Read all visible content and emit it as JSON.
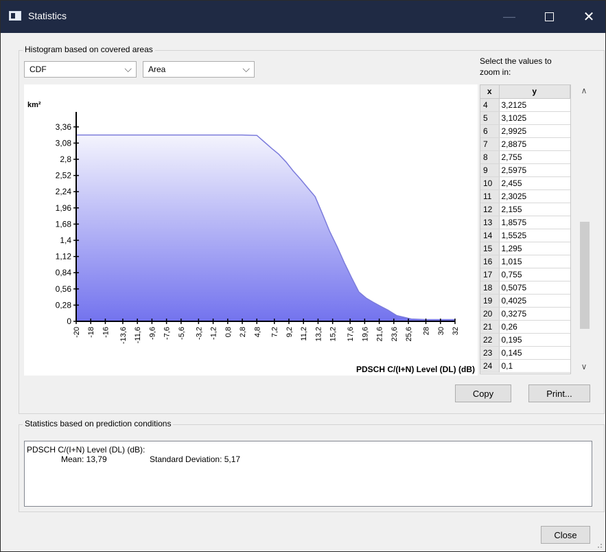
{
  "window": {
    "title": "Statistics",
    "minimize_glyph": "—",
    "close_glyph": "✕"
  },
  "histogram_group": {
    "label": "Histogram based on covered areas",
    "type_combo": {
      "value": "CDF"
    },
    "measure_combo": {
      "value": "Area"
    }
  },
  "zoom": {
    "label_line1": "Select the values to",
    "label_line2": "zoom in:",
    "table": {
      "headers": [
        "x",
        "y"
      ],
      "rows": [
        [
          "4",
          "3,2125"
        ],
        [
          "5",
          "3,1025"
        ],
        [
          "6",
          "2,9925"
        ],
        [
          "7",
          "2,8875"
        ],
        [
          "8",
          "2,755"
        ],
        [
          "9",
          "2,5975"
        ],
        [
          "10",
          "2,455"
        ],
        [
          "11",
          "2,3025"
        ],
        [
          "12",
          "2,155"
        ],
        [
          "13",
          "1,8575"
        ],
        [
          "14",
          "1,5525"
        ],
        [
          "15",
          "1,295"
        ],
        [
          "16",
          "1,015"
        ],
        [
          "17",
          "0,755"
        ],
        [
          "18",
          "0,5075"
        ],
        [
          "19",
          "0,4025"
        ],
        [
          "20",
          "0,3275"
        ],
        [
          "21",
          "0,26"
        ],
        [
          "22",
          "0,195"
        ],
        [
          "23",
          "0,145"
        ],
        [
          "24",
          "0,1"
        ]
      ]
    },
    "scroll_up_glyph": "∧",
    "scroll_down_glyph": "∨"
  },
  "buttons": {
    "copy": "Copy",
    "print": "Print...",
    "close": "Close"
  },
  "chart_data": {
    "type": "area",
    "ylabel": "km²",
    "xlabel": "PDSCH C/(I+N) Level (DL) (dB)",
    "y_ticks": [
      "0",
      "0,28",
      "0,56",
      "0,84",
      "1,12",
      "1,4",
      "1,68",
      "1,96",
      "2,24",
      "2,52",
      "2,8",
      "3,08",
      "3,36"
    ],
    "x_ticks": [
      "-20",
      "-18",
      "-16",
      "-13,6",
      "-11,6",
      "-9,6",
      "-7,6",
      "-5,6",
      "-3,2",
      "-1,2",
      "0,8",
      "2,8",
      "4,8",
      "7,2",
      "9,2",
      "11,2",
      "13,2",
      "15,2",
      "17,6",
      "19,6",
      "21,6",
      "23,6",
      "25,6",
      "28",
      "30",
      "32"
    ],
    "ylim": [
      0,
      3.5
    ],
    "x": [
      -20,
      2.8,
      4.8,
      5.8,
      6.8,
      7.8,
      8.8,
      9.8,
      10.8,
      11.8,
      12.8,
      13.8,
      14.8,
      15.8,
      16.8,
      17.8,
      18.8,
      19.8,
      20.8,
      21.8,
      22.8,
      24,
      26,
      28,
      32
    ],
    "y": [
      3.22,
      3.22,
      3.2125,
      3.1025,
      2.9925,
      2.8875,
      2.755,
      2.5975,
      2.455,
      2.3025,
      2.155,
      1.8575,
      1.5525,
      1.295,
      1.015,
      0.755,
      0.5075,
      0.4025,
      0.3275,
      0.26,
      0.195,
      0.1,
      0.04,
      0.03,
      0.03
    ],
    "fill_top_color": "#f4f4fd",
    "fill_bottom_color": "#7373ee",
    "line_color": "#7b7bdc",
    "grid": false
  },
  "prediction_group": {
    "label": "Statistics based on prediction conditions",
    "metric_line": "PDSCH C/(I+N) Level (DL) (dB):",
    "mean": "Mean: 13,79",
    "std": "Standard Deviation: 5,17"
  }
}
